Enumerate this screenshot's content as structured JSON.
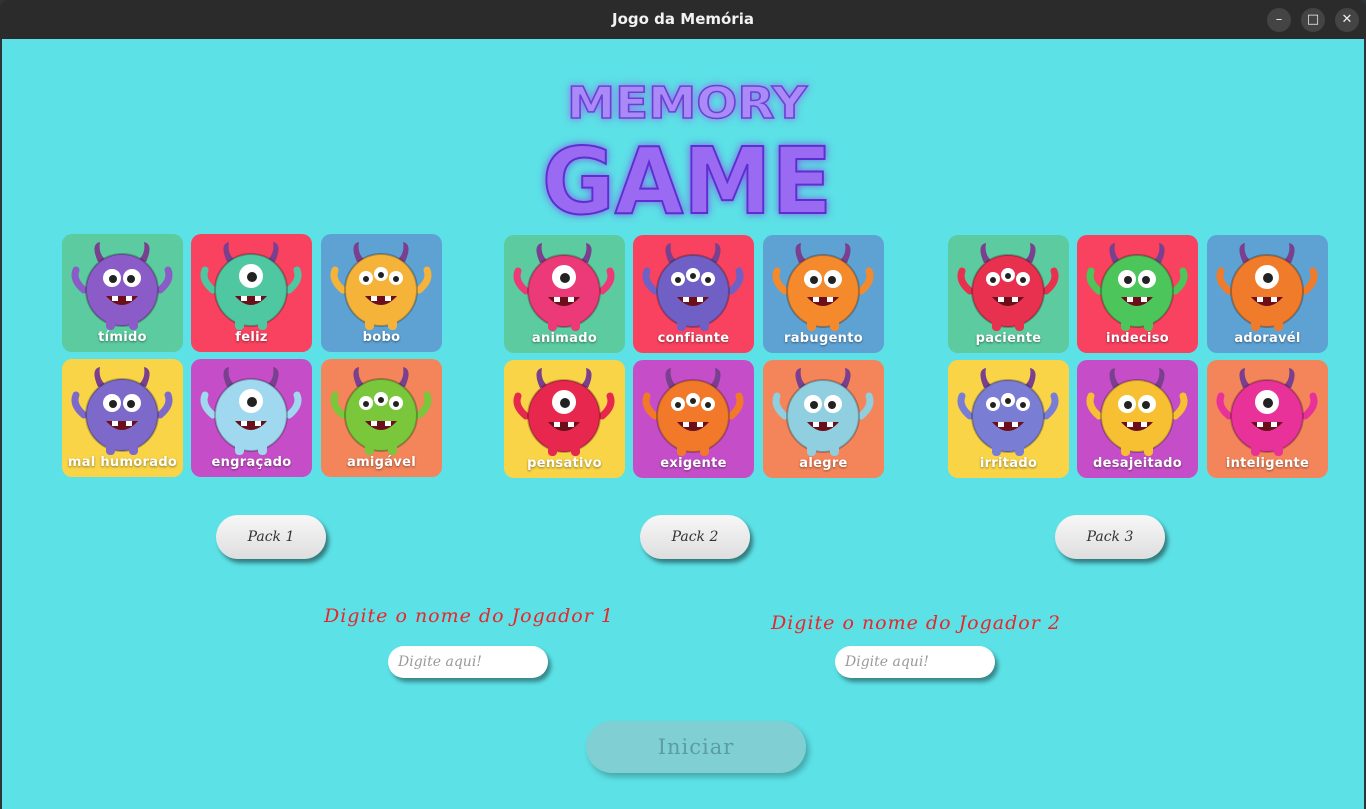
{
  "window": {
    "title": "Jogo da Memória",
    "controls": [
      "minimize",
      "maximize",
      "close"
    ]
  },
  "logo": {
    "line1": "MEMORY",
    "line2": "GAME"
  },
  "packs": [
    {
      "button_label": "Pack 1",
      "cards": [
        {
          "label": "tímido",
          "bg": "#5ccb9f",
          "monster": "#8b5cc7"
        },
        {
          "label": "feliz",
          "bg": "#f9425f",
          "monster": "#4fc7a0"
        },
        {
          "label": "bobo",
          "bg": "#5ea2d4",
          "monster": "#f6b33a"
        },
        {
          "label": "mal humorado",
          "bg": "#f9d447",
          "monster": "#7d69c9"
        },
        {
          "label": "engraçado",
          "bg": "#c54ec8",
          "monster": "#9fd8ef"
        },
        {
          "label": "amigável",
          "bg": "#f4855a",
          "monster": "#7ac73b"
        }
      ]
    },
    {
      "button_label": "Pack 2",
      "cards": [
        {
          "label": "animado",
          "bg": "#5ccb9f",
          "monster": "#ec3a78"
        },
        {
          "label": "confiante",
          "bg": "#f9425f",
          "monster": "#7060c5"
        },
        {
          "label": "rabugento",
          "bg": "#5ea2d4",
          "monster": "#f48a2c"
        },
        {
          "label": "pensativo",
          "bg": "#f9d447",
          "monster": "#e8274e"
        },
        {
          "label": "exigente",
          "bg": "#c54ec8",
          "monster": "#f2782a"
        },
        {
          "label": "alegre",
          "bg": "#f4855a",
          "monster": "#8fcfe0"
        }
      ]
    },
    {
      "button_label": "Pack 3",
      "cards": [
        {
          "label": "paciente",
          "bg": "#5ccb9f",
          "monster": "#e8304f"
        },
        {
          "label": "indeciso",
          "bg": "#f9425f",
          "monster": "#4cc65a"
        },
        {
          "label": "adoravél",
          "bg": "#5ea2d4",
          "monster": "#f07b2a"
        },
        {
          "label": "irritado",
          "bg": "#f9d447",
          "monster": "#7a7dd4"
        },
        {
          "label": "desajeitado",
          "bg": "#c54ec8",
          "monster": "#f7c033"
        },
        {
          "label": "inteligente",
          "bg": "#f4855a",
          "monster": "#e8329a"
        }
      ]
    }
  ],
  "player1": {
    "prompt": "Digite o nome do Jogador 1",
    "placeholder": "Digite aqui!",
    "value": ""
  },
  "player2": {
    "prompt": "Digite o nome do Jogador 2",
    "placeholder": "Digite aqui!",
    "value": ""
  },
  "start_button": {
    "label": "Iniciar",
    "enabled": false
  },
  "colors": {
    "background": "#5ce1e6",
    "prompt_text": "#e8252b",
    "logo_purple": "#8f5cf2"
  }
}
